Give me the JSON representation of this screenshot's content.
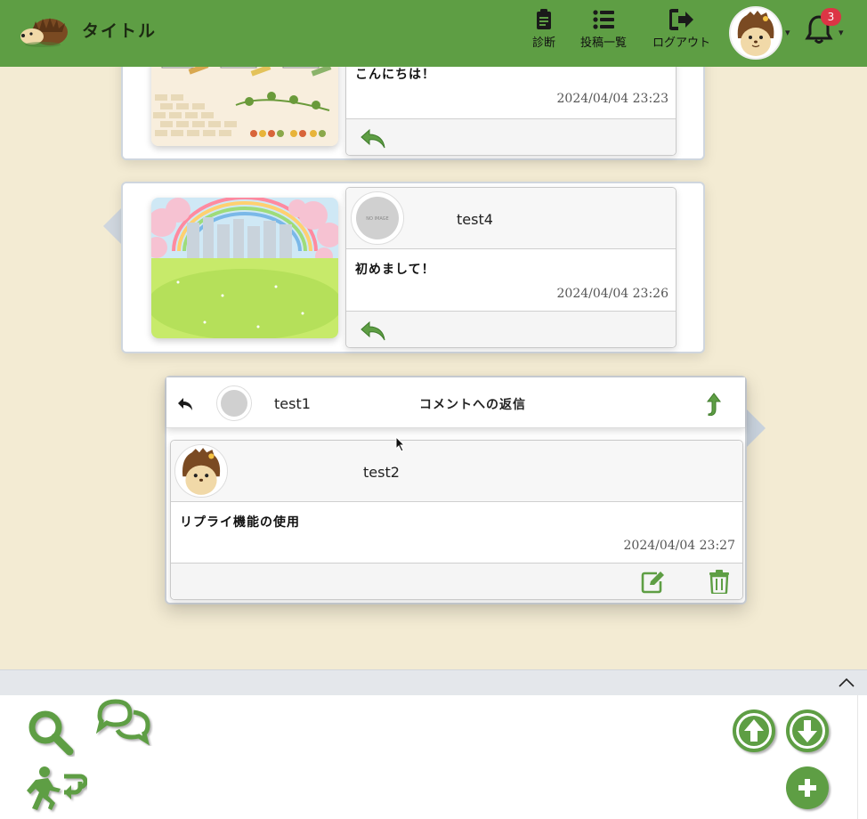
{
  "header": {
    "title": "タイトル",
    "nav": [
      {
        "label": "診断",
        "icon": "clipboard-icon"
      },
      {
        "label": "投稿一覧",
        "icon": "list-icon"
      },
      {
        "label": "ログアウト",
        "icon": "logout-icon"
      }
    ],
    "notification_count": "3"
  },
  "posts": [
    {
      "message": "こんにちは！",
      "date": "2024/04/04 23:23"
    },
    {
      "user": "test4",
      "avatar_text": "NO IMAGE",
      "message": "初めまして！",
      "date": "2024/04/04 23:26"
    }
  ],
  "reply_popup": {
    "parent_user": "test1",
    "title": "コメントへの返信",
    "reply": {
      "user": "test2",
      "message": "リプライ機能の使用",
      "date": "2024/04/04 23:27"
    }
  },
  "colors": {
    "header_green": "#5e9e44",
    "icon_green": "#5e9e44",
    "background": "#f3ebd3",
    "badge_red": "#dc3545"
  }
}
